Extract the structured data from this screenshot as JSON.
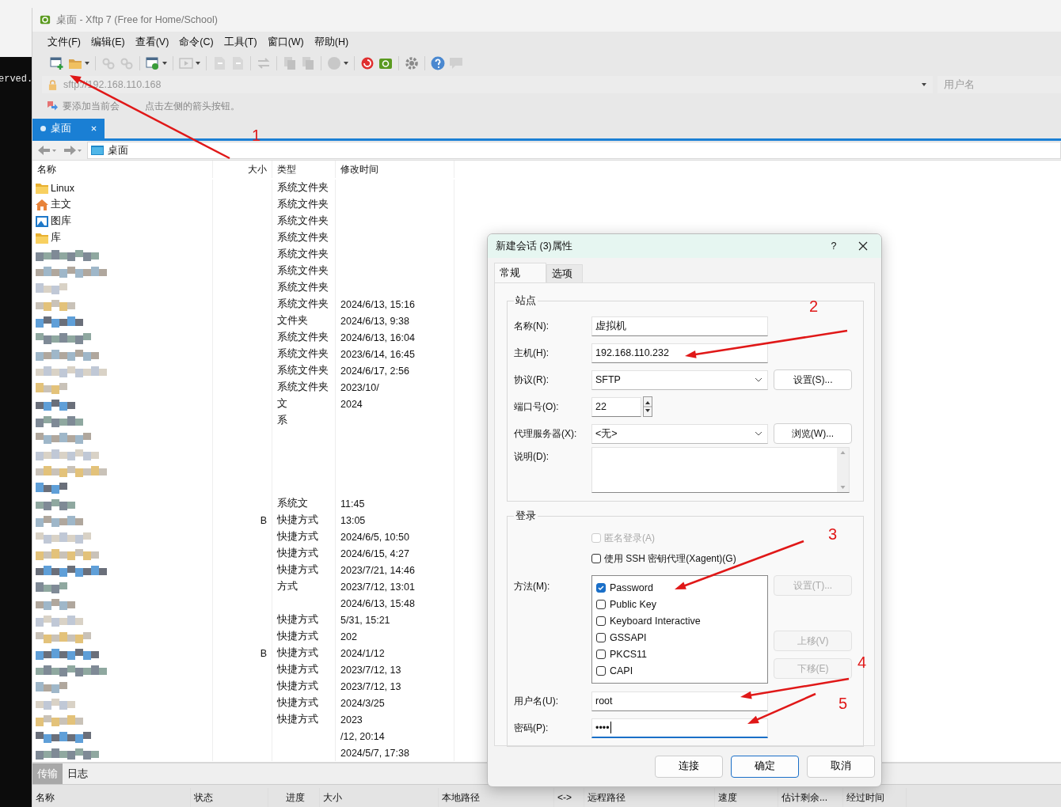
{
  "terminal": {
    "text": "erved."
  },
  "window": {
    "title": "桌面 - Xftp 7 (Free for Home/School)",
    "menu": [
      "文件(F)",
      "编辑(E)",
      "查看(V)",
      "命令(C)",
      "工具(T)",
      "窗口(W)",
      "帮助(H)"
    ],
    "address": "sftp://192.168.110.168",
    "user_placeholder": "用户名",
    "hint_parts": [
      "要添加当前会",
      "点击左侧的箭头按钮。"
    ],
    "tabs": [
      {
        "label": "桌面",
        "selected": true
      }
    ],
    "path": "桌面"
  },
  "file_list": {
    "columns": [
      "名称",
      "大小",
      "类型",
      "修改时间"
    ],
    "rows": [
      {
        "kind": "folder",
        "name": "Linux",
        "type": "系统文件夹"
      },
      {
        "kind": "home",
        "name": "主文",
        "type": "系统文件夹"
      },
      {
        "kind": "gallery",
        "name": "图库",
        "type": "系统文件夹"
      },
      {
        "kind": "folder",
        "name": "库",
        "type": "系统文件夹"
      },
      {
        "kind": "pixelated",
        "type": "系统文件夹"
      },
      {
        "kind": "pixelated",
        "type": "系统文件夹"
      },
      {
        "kind": "pixelated",
        "type": "系统文件夹"
      },
      {
        "kind": "pixelated",
        "type": "系统文件夹",
        "date": "2024/6/13, 15:16"
      },
      {
        "kind": "pixelated",
        "type": "文件夹",
        "date": "2024/6/13, 9:38"
      },
      {
        "kind": "pixelated",
        "type": "系统文件夹",
        "date": "2024/6/13, 16:04"
      },
      {
        "kind": "pixelated",
        "type": "系统文件夹",
        "date": "2023/6/14, 16:45"
      },
      {
        "kind": "pixelated",
        "type": "系统文件夹",
        "date": "2024/6/17, 2:56"
      },
      {
        "kind": "pixelated",
        "type": "系统文件夹",
        "date": "2023/10/"
      },
      {
        "kind": "pixelated",
        "type": "文",
        "date": "2024"
      },
      {
        "kind": "pixelated",
        "type": "系"
      },
      {
        "kind": "pixelated"
      },
      {
        "kind": "pixelated"
      },
      {
        "kind": "pixelated"
      },
      {
        "kind": "pixelated"
      },
      {
        "kind": "pixelated",
        "type": "系统文",
        "date": "11:45"
      },
      {
        "kind": "pixelated",
        "size": "B",
        "type": "快捷方式",
        "date": "13:05"
      },
      {
        "kind": "pixelated",
        "type": "快捷方式",
        "date": "2024/6/5, 10:50"
      },
      {
        "kind": "pixelated",
        "type": "快捷方式",
        "date": "2024/6/15, 4:27"
      },
      {
        "kind": "pixelated",
        "type": "快捷方式",
        "date": "2023/7/21, 14:46"
      },
      {
        "kind": "pixelated",
        "type": "方式",
        "date": "2023/7/12, 13:01"
      },
      {
        "kind": "pixelated",
        "date": "2024/6/13, 15:48"
      },
      {
        "kind": "pixelated",
        "type": "快捷方式",
        "date": "5/31, 15:21"
      },
      {
        "kind": "pixelated",
        "type": "快捷方式",
        "date": "202"
      },
      {
        "kind": "pixelated",
        "size": "B",
        "type": "快捷方式",
        "date": "2024/1/12"
      },
      {
        "kind": "pixelated",
        "type": "快捷方式",
        "date": "2023/7/12, 13"
      },
      {
        "kind": "pixelated",
        "type": "快捷方式",
        "date": "2023/7/12, 13"
      },
      {
        "kind": "pixelated",
        "type": "快捷方式",
        "date": "2024/3/25"
      },
      {
        "kind": "pixelated",
        "type": "快捷方式",
        "date": "2023"
      },
      {
        "kind": "pixelated",
        "date": "/12, 20:14"
      },
      {
        "kind": "pixelated",
        "date": "2024/5/7, 17:38"
      }
    ]
  },
  "transfer_panel": {
    "tabs": [
      {
        "label": "传输",
        "selected": true
      },
      {
        "label": "日志",
        "selected": false
      }
    ],
    "columns": [
      "名称",
      "状态",
      "进度",
      "大小",
      "本地路径",
      "<->",
      "远程路径",
      "速度",
      "估计剩余...",
      "经过时间"
    ]
  },
  "dialog": {
    "title": "新建会话 (3)属性",
    "help": "?",
    "tabs": [
      {
        "label": "常规",
        "selected": true
      },
      {
        "label": "选项",
        "selected": false
      }
    ],
    "site": {
      "legend": "站点",
      "fields": [
        {
          "label": "名称(N):",
          "kind": "text",
          "value": "虚拟机"
        },
        {
          "label": "主机(H):",
          "kind": "text",
          "value": "192.168.110.232"
        },
        {
          "label": "协议(R):",
          "kind": "select",
          "value": "SFTP",
          "button": "设置(S)..."
        },
        {
          "label": "端口号(O):",
          "kind": "spin",
          "value": "22"
        },
        {
          "label": "代理服务器(X):",
          "kind": "select",
          "value": "<无>",
          "button": "浏览(W)..."
        },
        {
          "label": "说明(D):",
          "kind": "textarea"
        }
      ]
    },
    "login": {
      "legend": "登录",
      "options": [
        {
          "label": "匿名登录(A)",
          "checked": false,
          "disabled": true
        },
        {
          "label": "使用 SSH 密钥代理(Xagent)(G)",
          "checked": false,
          "disabled": false
        }
      ],
      "method_label": "方法(M):",
      "methods": [
        {
          "label": "Password",
          "checked": true
        },
        {
          "label": "Public Key",
          "checked": false
        },
        {
          "label": "Keyboard Interactive",
          "checked": false
        },
        {
          "label": "GSSAPI",
          "checked": false
        },
        {
          "label": "PKCS11",
          "checked": false
        },
        {
          "label": "CAPI",
          "checked": false
        }
      ],
      "method_buttons": [
        {
          "label": "设置(T)...",
          "disabled": true
        },
        {
          "label": "上移(V)",
          "disabled": true
        },
        {
          "label": "下移(E)",
          "disabled": true
        }
      ],
      "username": {
        "label": "用户名(U):",
        "value": "root"
      },
      "password": {
        "label": "密码(P):",
        "value": "••••",
        "focused": true
      }
    },
    "buttons": [
      {
        "label": "连接",
        "default": false
      },
      {
        "label": "确定",
        "default": true
      },
      {
        "label": "取消",
        "default": false
      }
    ]
  },
  "annotations": [
    {
      "label": "1"
    },
    {
      "label": "2"
    },
    {
      "label": "3"
    },
    {
      "label": "4"
    },
    {
      "label": "5"
    }
  ]
}
